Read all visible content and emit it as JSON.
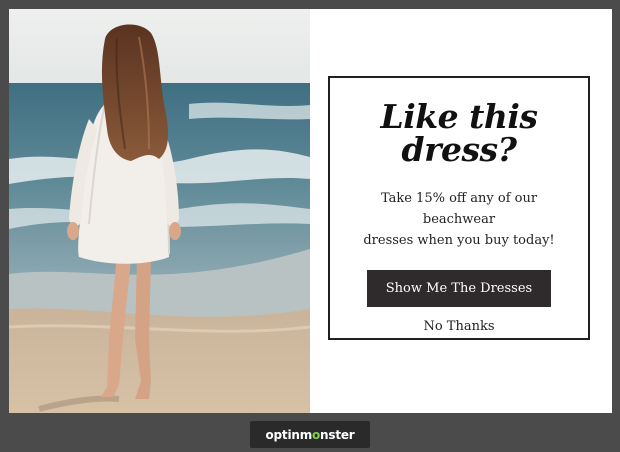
{
  "popup": {
    "headline_line1": "Like this",
    "headline_line2": "dress?",
    "body_line1": "Take 15% off any of our beachwear",
    "body_line2": "dresses when you buy today!",
    "cta_label": "Show Me The Dresses",
    "dismiss_label": "No Thanks",
    "image_icon": "beach-woman-photo"
  },
  "footer": {
    "brand_prefix": "optinm",
    "brand_accent": "o",
    "brand_suffix": "nster"
  },
  "colors": {
    "background": "#4b4b4b",
    "button": "#2f2a2b",
    "border": "#231f20",
    "brand_accent": "#7fd14a"
  }
}
